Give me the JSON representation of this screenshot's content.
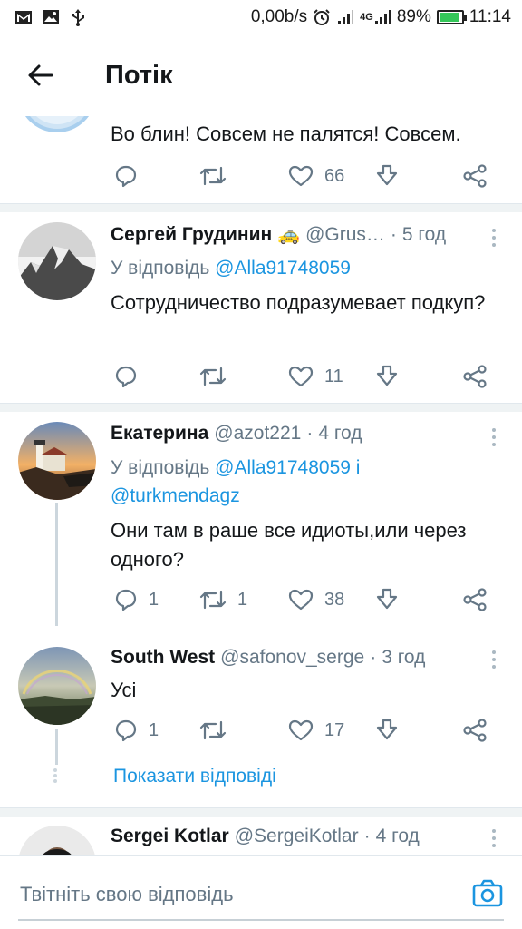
{
  "status_bar": {
    "net_speed": "0,00b/s",
    "network_type": "4G",
    "battery_percent": "89%",
    "battery_level": 0.89,
    "time": "11:14",
    "icons": [
      "gmail-icon",
      "image-icon",
      "usb-icon",
      "alarm-icon",
      "signal-icon",
      "signal-4g-icon",
      "battery-icon"
    ]
  },
  "header": {
    "title": "Потік",
    "back_icon": "arrow-left-icon"
  },
  "colors": {
    "link": "#1b95e0",
    "text": "#14171a",
    "secondary": "#657786",
    "divider": "#eff3f4"
  },
  "tweets": [
    {
      "text": "Во блин! Совсем не палятся! Совсем.",
      "reply_count": "",
      "retweet_count": "",
      "like_count": "66"
    },
    {
      "name": "Сергей Грудинин",
      "emoji": "🚕",
      "handle": "@Grus…",
      "dot": "·",
      "time": "5 год",
      "reply_prefix": "У відповідь",
      "reply_to": "@Alla91748059",
      "text": "Сотрудничество подразумевает подкуп?",
      "reply_count": "",
      "retweet_count": "",
      "like_count": "11"
    },
    {
      "name": "Екатерина",
      "handle": "@azot221",
      "dot": "·",
      "time": "4 год",
      "reply_prefix": "У відповідь",
      "reply_to": "@Alla91748059",
      "reply_conj": "і",
      "reply_to_2": "@turkmendagz",
      "text": "Они там в раше все идиоты,или через одного?",
      "reply_count": "1",
      "retweet_count": "1",
      "like_count": "38"
    },
    {
      "name": "South West",
      "handle": "@safonov_serge",
      "dot": "·",
      "time": "3 год",
      "text": "Усі",
      "reply_count": "1",
      "retweet_count": "",
      "like_count": "17"
    },
    {
      "name": "Sergei Kotlar",
      "handle": "@SergeiKotlar",
      "dot": "·",
      "time": "4 год"
    }
  ],
  "show_replies": "Показати відповіді",
  "compose": {
    "placeholder": "Твітніть свою відповідь",
    "camera_icon": "camera-icon"
  }
}
